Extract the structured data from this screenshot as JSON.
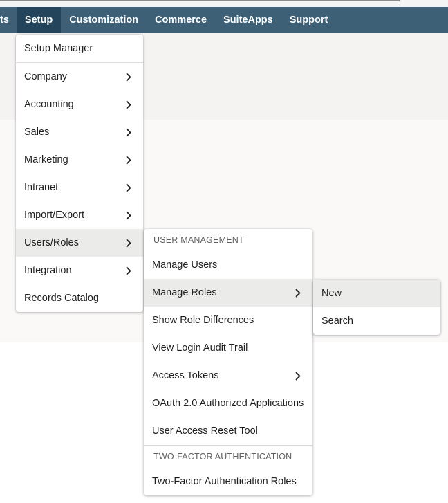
{
  "nav": {
    "items": [
      {
        "label": "ts",
        "active": false
      },
      {
        "label": "Setup",
        "active": true
      },
      {
        "label": "Customization",
        "active": false
      },
      {
        "label": "Commerce",
        "active": false
      },
      {
        "label": "SuiteApps",
        "active": false
      },
      {
        "label": "Support",
        "active": false
      }
    ]
  },
  "setup_menu": {
    "items": [
      {
        "label": "Setup Manager",
        "submenu": false
      },
      {
        "label": "Company",
        "submenu": true
      },
      {
        "label": "Accounting",
        "submenu": true
      },
      {
        "label": "Sales",
        "submenu": true
      },
      {
        "label": "Marketing",
        "submenu": true
      },
      {
        "label": "Intranet",
        "submenu": true
      },
      {
        "label": "Import/Export",
        "submenu": true
      },
      {
        "label": "Users/Roles",
        "submenu": true,
        "highlighted": true
      },
      {
        "label": "Integration",
        "submenu": true
      },
      {
        "label": "Records Catalog",
        "submenu": false
      }
    ]
  },
  "users_roles_menu": {
    "header_user_management": "USER MANAGEMENT",
    "items": [
      {
        "label": "Manage Users",
        "submenu": false
      },
      {
        "label": "Manage Roles",
        "submenu": true,
        "highlighted": true
      },
      {
        "label": "Show Role Differences",
        "submenu": false
      },
      {
        "label": "View Login Audit Trail",
        "submenu": false
      },
      {
        "label": "Access Tokens",
        "submenu": true
      },
      {
        "label": "OAuth 2.0 Authorized Applications",
        "submenu": false
      },
      {
        "label": "User Access Reset Tool",
        "submenu": false
      }
    ],
    "header_two_factor": "TWO-FACTOR AUTHENTICATION",
    "two_factor_items": [
      {
        "label": "Two-Factor Authentication Roles",
        "submenu": false
      }
    ]
  },
  "manage_roles_menu": {
    "items": [
      {
        "label": "New",
        "highlighted": true
      },
      {
        "label": "Search",
        "highlighted": false
      }
    ]
  },
  "colors": {
    "navbar": "#3d6077",
    "nav_active": "#23445a",
    "hover": "#ebebea"
  }
}
